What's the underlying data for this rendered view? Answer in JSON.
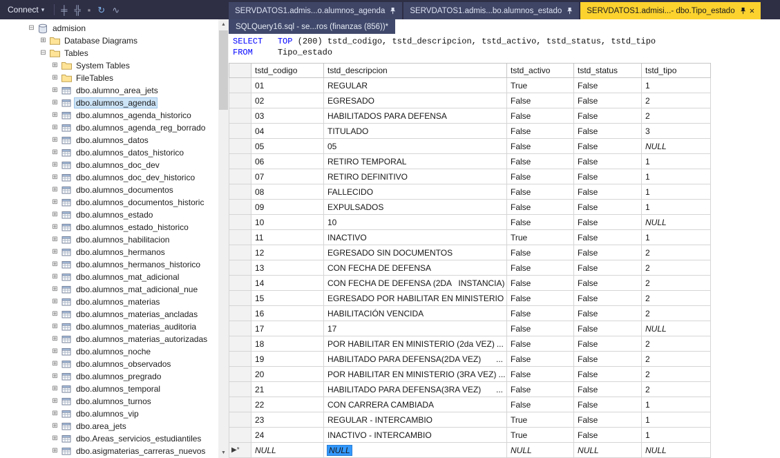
{
  "object_explorer": {
    "toolbar": {
      "connect_label": "Connect",
      "connect_caret": "▾",
      "icons": [
        {
          "name": "attach-plug-icon",
          "glyph": "╪"
        },
        {
          "name": "detach-plug-icon",
          "glyph": "╬"
        },
        {
          "name": "stop-icon",
          "glyph": "▪"
        },
        {
          "name": "refresh-icon",
          "glyph": "↻"
        },
        {
          "name": "activity-monitor-icon",
          "glyph": "∿"
        }
      ]
    },
    "scrollbar": {
      "up": "▲",
      "down": "▼"
    },
    "tree": {
      "glyphs": {
        "expand": "⊞",
        "collapse": "⊟"
      },
      "items": [
        {
          "label": "admision",
          "depth": 0,
          "icon": "database",
          "state": "expanded"
        },
        {
          "label": "Database Diagrams",
          "depth": 1,
          "icon": "folder",
          "state": "collapsed"
        },
        {
          "label": "Tables",
          "depth": 1,
          "icon": "folder",
          "state": "expanded"
        },
        {
          "label": "System Tables",
          "depth": 2,
          "icon": "folder",
          "state": "collapsed"
        },
        {
          "label": "FileTables",
          "depth": 2,
          "icon": "folder",
          "state": "collapsed"
        },
        {
          "label": "dbo.alumno_area_jets",
          "depth": 2,
          "icon": "table",
          "state": "collapsed"
        },
        {
          "label": "dbo.alumnos_agenda",
          "depth": 2,
          "icon": "table",
          "state": "collapsed",
          "selected": true
        },
        {
          "label": "dbo.alumnos_agenda_historico",
          "depth": 2,
          "icon": "table",
          "state": "collapsed"
        },
        {
          "label": "dbo.alumnos_agenda_reg_borrado",
          "depth": 2,
          "icon": "table",
          "state": "collapsed"
        },
        {
          "label": "dbo.alumnos_datos",
          "depth": 2,
          "icon": "table",
          "state": "collapsed"
        },
        {
          "label": "dbo.alumnos_datos_historico",
          "depth": 2,
          "icon": "table",
          "state": "collapsed"
        },
        {
          "label": "dbo.alumnos_doc_dev",
          "depth": 2,
          "icon": "table",
          "state": "collapsed"
        },
        {
          "label": "dbo.alumnos_doc_dev_historico",
          "depth": 2,
          "icon": "table",
          "state": "collapsed"
        },
        {
          "label": "dbo.alumnos_documentos",
          "depth": 2,
          "icon": "table",
          "state": "collapsed"
        },
        {
          "label": "dbo.alumnos_documentos_historic",
          "depth": 2,
          "icon": "table",
          "state": "collapsed"
        },
        {
          "label": "dbo.alumnos_estado",
          "depth": 2,
          "icon": "table",
          "state": "collapsed"
        },
        {
          "label": "dbo.alumnos_estado_historico",
          "depth": 2,
          "icon": "table",
          "state": "collapsed"
        },
        {
          "label": "dbo.alumnos_habilitacion",
          "depth": 2,
          "icon": "table",
          "state": "collapsed"
        },
        {
          "label": "dbo.alumnos_hermanos",
          "depth": 2,
          "icon": "table",
          "state": "collapsed"
        },
        {
          "label": "dbo.alumnos_hermanos_historico",
          "depth": 2,
          "icon": "table",
          "state": "collapsed"
        },
        {
          "label": "dbo.alumnos_mat_adicional",
          "depth": 2,
          "icon": "table",
          "state": "collapsed"
        },
        {
          "label": "dbo.alumnos_mat_adicional_nue",
          "depth": 2,
          "icon": "table",
          "state": "collapsed"
        },
        {
          "label": "dbo.alumnos_materias",
          "depth": 2,
          "icon": "table",
          "state": "collapsed"
        },
        {
          "label": "dbo.alumnos_materias_ancladas",
          "depth": 2,
          "icon": "table",
          "state": "collapsed"
        },
        {
          "label": "dbo.alumnos_materias_auditoria",
          "depth": 2,
          "icon": "table",
          "state": "collapsed"
        },
        {
          "label": "dbo.alumnos_materias_autorizadas",
          "depth": 2,
          "icon": "table",
          "state": "collapsed"
        },
        {
          "label": "dbo.alumnos_noche",
          "depth": 2,
          "icon": "table",
          "state": "collapsed"
        },
        {
          "label": "dbo.alumnos_observados",
          "depth": 2,
          "icon": "table",
          "state": "collapsed"
        },
        {
          "label": "dbo.alumnos_pregrado",
          "depth": 2,
          "icon": "table",
          "state": "collapsed"
        },
        {
          "label": "dbo.alumnos_temporal",
          "depth": 2,
          "icon": "table",
          "state": "collapsed"
        },
        {
          "label": "dbo.alumnos_turnos",
          "depth": 2,
          "icon": "table",
          "state": "collapsed"
        },
        {
          "label": "dbo.alumnos_vip",
          "depth": 2,
          "icon": "table",
          "state": "collapsed"
        },
        {
          "label": "dbo.area_jets",
          "depth": 2,
          "icon": "table",
          "state": "collapsed"
        },
        {
          "label": "dbo.Areas_servicios_estudiantiles",
          "depth": 2,
          "icon": "table",
          "state": "collapsed"
        },
        {
          "label": "dbo.asigmaterias_carreras_nuevos",
          "depth": 2,
          "icon": "table",
          "state": "collapsed"
        }
      ]
    }
  },
  "tabs": {
    "close_glyph": "×",
    "pinned": [
      {
        "label": "SERVDATOS1.admis...o.alumnos_agenda",
        "pinned": true,
        "active": false
      },
      {
        "label": "SERVDATOS1.admis...bo.alumnos_estado",
        "pinned": true,
        "active": false
      },
      {
        "label": "SERVDATOS1.admisi...- dbo.Tipo_estado",
        "pinned": true,
        "active": true
      }
    ],
    "row2": {
      "label": "SQLQuery16.sql - se...ros (finanzas (856))*"
    }
  },
  "sql": {
    "lines": [
      [
        {
          "t": "SELECT",
          "k": true
        },
        {
          "t": "   "
        },
        {
          "t": "TOP",
          "k": true
        },
        {
          "t": " (200) tstd_codigo, tstd_descripcion, tstd_activo, tstd_status, tstd_tipo"
        }
      ],
      [
        {
          "t": "FROM",
          "k": true
        },
        {
          "t": "     Tipo_estado"
        }
      ]
    ]
  },
  "grid": {
    "columns": [
      "tstd_codigo",
      "tstd_descripcion",
      "tstd_activo",
      "tstd_status",
      "tstd_tipo"
    ],
    "truncation_marker": "...",
    "new_row_marker": "▶*",
    "rows": [
      {
        "codigo": "01",
        "descripcion": "REGULAR",
        "activo": "True",
        "status": "False",
        "tipo": "1",
        "truncated": false
      },
      {
        "codigo": "02",
        "descripcion": "EGRESADO",
        "activo": "False",
        "status": "False",
        "tipo": "2",
        "truncated": false
      },
      {
        "codigo": "03",
        "descripcion": "HABILITADOS PARA DEFENSA",
        "activo": "False",
        "status": "False",
        "tipo": "2",
        "truncated": false
      },
      {
        "codigo": "04",
        "descripcion": "TITULADO",
        "activo": "False",
        "status": "False",
        "tipo": "3",
        "truncated": false
      },
      {
        "codigo": "05",
        "descripcion": "05",
        "activo": "False",
        "status": "False",
        "tipo": "NULL",
        "truncated": false
      },
      {
        "codigo": "06",
        "descripcion": "RETIRO TEMPORAL",
        "activo": "False",
        "status": "False",
        "tipo": "1",
        "truncated": false
      },
      {
        "codigo": "07",
        "descripcion": "RETIRO DEFINITIVO",
        "activo": "False",
        "status": "False",
        "tipo": "1",
        "truncated": false
      },
      {
        "codigo": "08",
        "descripcion": "FALLECIDO",
        "activo": "False",
        "status": "False",
        "tipo": "1",
        "truncated": false
      },
      {
        "codigo": "09",
        "descripcion": "EXPULSADOS",
        "activo": "False",
        "status": "False",
        "tipo": "1",
        "truncated": false
      },
      {
        "codigo": "10",
        "descripcion": "10",
        "activo": "False",
        "status": "False",
        "tipo": "NULL",
        "truncated": false
      },
      {
        "codigo": "11",
        "descripcion": "INACTIVO",
        "activo": "True",
        "status": "False",
        "tipo": "1",
        "truncated": false
      },
      {
        "codigo": "12",
        "descripcion": "EGRESADO SIN DOCUMENTOS",
        "activo": "False",
        "status": "False",
        "tipo": "2",
        "truncated": false
      },
      {
        "codigo": "13",
        "descripcion": "CON FECHA DE DEFENSA",
        "activo": "False",
        "status": "False",
        "tipo": "2",
        "truncated": false
      },
      {
        "codigo": "14",
        "descripcion": "CON FECHA DE DEFENSA (2DA   INSTANCIA)",
        "activo": "False",
        "status": "False",
        "tipo": "2",
        "truncated": true
      },
      {
        "codigo": "15",
        "descripcion": "EGRESADO POR HABILITAR EN MINISTERIO",
        "activo": "False",
        "status": "False",
        "tipo": "2",
        "truncated": true
      },
      {
        "codigo": "16",
        "descripcion": "HABILITACIÓN VENCIDA",
        "activo": "False",
        "status": "False",
        "tipo": "2",
        "truncated": false
      },
      {
        "codigo": "17",
        "descripcion": "17",
        "activo": "False",
        "status": "False",
        "tipo": "NULL",
        "truncated": false
      },
      {
        "codigo": "18",
        "descripcion": "POR HABILITAR EN MINISTERIO (2da VEZ)",
        "activo": "False",
        "status": "False",
        "tipo": "2",
        "truncated": true
      },
      {
        "codigo": "19",
        "descripcion": "HABILITADO PARA DEFENSA(2DA VEZ)",
        "activo": "False",
        "status": "False",
        "tipo": "2",
        "truncated": true
      },
      {
        "codigo": "20",
        "descripcion": "POR HABILITAR EN MINISTERIO (3RA VEZ)",
        "activo": "False",
        "status": "False",
        "tipo": "2",
        "truncated": true
      },
      {
        "codigo": "21",
        "descripcion": "HABILITADO PARA DEFENSA(3RA VEZ)",
        "activo": "False",
        "status": "False",
        "tipo": "2",
        "truncated": true
      },
      {
        "codigo": "22",
        "descripcion": "CON CARRERA CAMBIADA",
        "activo": "False",
        "status": "False",
        "tipo": "1",
        "truncated": false
      },
      {
        "codigo": "23",
        "descripcion": "REGULAR - INTERCAMBIO",
        "activo": "True",
        "status": "False",
        "tipo": "1",
        "truncated": false
      },
      {
        "codigo": "24",
        "descripcion": "INACTIVO - INTERCAMBIO",
        "activo": "True",
        "status": "False",
        "tipo": "1",
        "truncated": false
      }
    ],
    "new_row": {
      "codigo": "NULL",
      "descripcion": "NULL",
      "activo": "NULL",
      "status": "NULL",
      "tipo": "NULL",
      "selected_column": "descripcion"
    }
  },
  "colors": {
    "active_tab": "#fcd22e",
    "selection": "#3399ff",
    "keyword": "#0000ff",
    "env_dark": "#2e2e45"
  }
}
